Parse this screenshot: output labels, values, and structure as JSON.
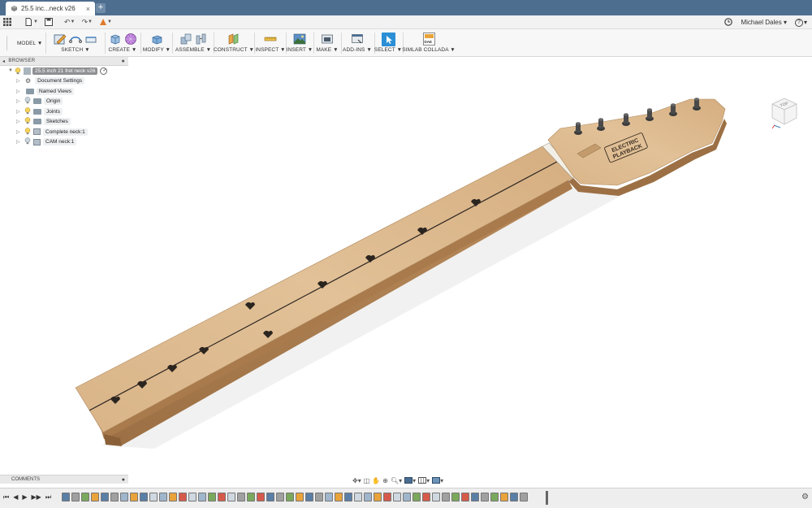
{
  "window": {
    "tab_title": "25.5 inc...neck v26",
    "tab_close": "×",
    "new_tab": "+"
  },
  "user": {
    "name": "Michael Dales",
    "help": "?"
  },
  "workspace": {
    "mode_label": "MODEL"
  },
  "ribbon": {
    "groups": [
      {
        "label": "SKETCH"
      },
      {
        "label": "CREATE"
      },
      {
        "label": "MODIFY"
      },
      {
        "label": "ASSEMBLE"
      },
      {
        "label": "CONSTRUCT"
      },
      {
        "label": "INSPECT"
      },
      {
        "label": "INSERT"
      },
      {
        "label": "MAKE"
      },
      {
        "label": "ADD-INS"
      },
      {
        "label": "SELECT"
      },
      {
        "label": "SIMLAB COLLADA"
      }
    ],
    "simlab_badge": "DAE"
  },
  "browser": {
    "title": "BROWSER",
    "root": "25.5 inch 21 fret neck v26",
    "nodes": [
      {
        "label": "Document Settings"
      },
      {
        "label": "Named Views"
      },
      {
        "label": "Origin"
      },
      {
        "label": "Joints"
      },
      {
        "label": "Sketches"
      },
      {
        "label": "Complete neck:1"
      },
      {
        "label": "CAM neck:1"
      }
    ]
  },
  "comments": {
    "title": "COMMENTS"
  },
  "viewcube": {
    "face_label": "TOP"
  },
  "model": {
    "headstock_logo_line1": "ELECTRIC",
    "headstock_logo_line2": "PLAYBACK"
  },
  "colors": {
    "titlebar": "#4d6e8f",
    "select_accent": "#2b8fd6",
    "wood": "#d8b487"
  }
}
